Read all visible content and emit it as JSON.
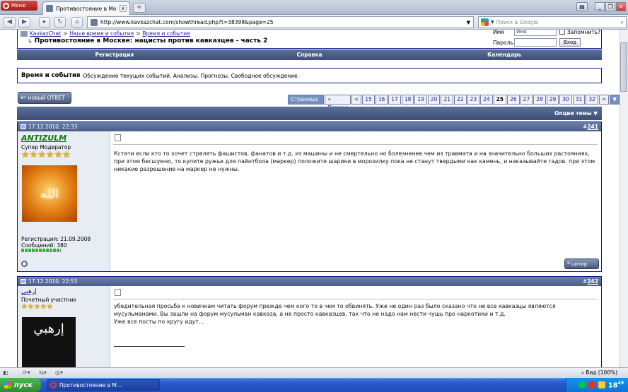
{
  "browser": {
    "menu_label": "Меню",
    "tab_title": "Противостояние в Моск...",
    "tab_close": "x",
    "new_tab": "+",
    "url": "http://www.kavkazchat.com/showthread.php?t=38398&page=25",
    "search_placeholder": "Поиск в Google",
    "zoom": "Вид (100%)"
  },
  "breadcrumb": {
    "site": "KavkazChat",
    "section1": "Наше время и события",
    "section2": "Время и события",
    "sep": ">",
    "thread_title": "Противостояние в Москве: нацисты против кавказцев - часть 2"
  },
  "login": {
    "name_label": "Имя",
    "name_placeholder": "Имя",
    "remember_label": "Запомнить?",
    "password_label": "Пароль",
    "login_button": "Вход"
  },
  "navbar": {
    "register": "Регистрация",
    "help": "Справка",
    "calendar": "Календарь"
  },
  "forum_info": {
    "title": "Время и события",
    "description": "Обсуждение текущих событий. Анализы. Прогнозы. Свободное обсуждение."
  },
  "reply_button": "новый ОТВЕТ",
  "pagination": {
    "label": "Страница 25 из 32",
    "first": "« Первая",
    "prev": "<",
    "pages": [
      "15",
      "16",
      "17",
      "18",
      "19",
      "20",
      "21",
      "22",
      "23",
      "24",
      "25",
      "26",
      "27",
      "28",
      "29",
      "30",
      "31",
      "32"
    ],
    "current": "25",
    "next": ">",
    "menu": "▼"
  },
  "thread_tools": "Опции темы ▼",
  "posts": [
    {
      "date": "17.12.2010, 22:33",
      "number_prefix": "#",
      "number": "241",
      "username": "ANTIZULM",
      "user_title": "Супер Модератор",
      "stars": 5,
      "registration": "Регистрация: 21.09.2008",
      "message_count": "Сообщений: 380",
      "avatar_glyph": "الله",
      "text": "Кстати если кто то хочет стрелять фашистов, фанатов и т.д. из машины и не смертельно но болезненее чем из травмата и на значительно больших растояниях, при этом бесшумно, то купите ружье для пайнтбола (маркер) положите шарики в морозилку пока не станут твердыми как камень, и наказывайте гадов. при этом никакие разрешение на маркер не нужны.",
      "quote_button": "цитир."
    },
    {
      "date": "17.12.2010, 22:53",
      "number_prefix": "#",
      "number": "242",
      "username": "إرهبي",
      "user_title": "Почетный участник",
      "stars": 5,
      "avatar_glyph": "إرهبي",
      "text_lines": [
        "убедительная просьба к новичкам читать форум прежде чем кого то в чем то обвинять. Уже не один раз было сказано что не все кавказцы являются мусульманами. Вы зашли на форум мусульман кавказа, а не просто кавказцев, так что не надо нам нести чушь про наркотики и т.д.",
        "Уже все посты по кругу идут..."
      ]
    }
  ],
  "taskbar": {
    "start": "пуск",
    "task": "Противостояние в М...",
    "clock": "18",
    "clock_min": "49"
  },
  "colors": {
    "header_blue": "#3c4f7a",
    "link": "#22229c",
    "username_green": "#0d7a0d",
    "star": "#e3b51e"
  }
}
